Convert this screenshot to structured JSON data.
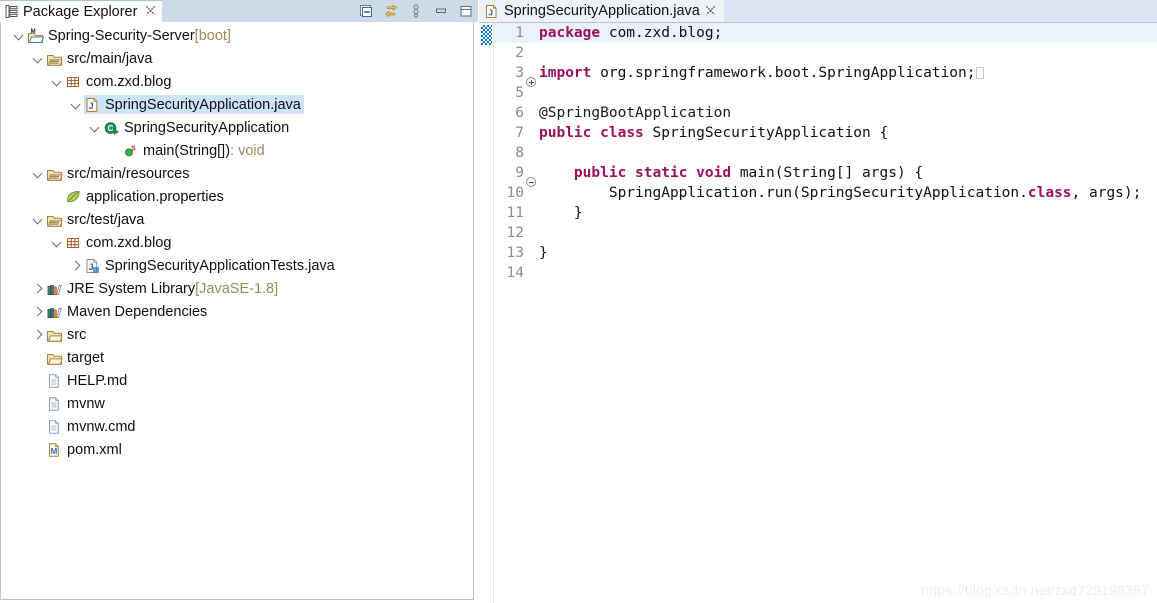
{
  "explorer": {
    "tab": {
      "title": "Package Explorer",
      "close": "✖",
      "icon": "package-explorer-icon"
    },
    "toolbar": [
      {
        "name": "collapse-all-button",
        "title": "Collapse All"
      },
      {
        "name": "link-with-editor-button",
        "title": "Link with Editor"
      },
      {
        "name": "view-menu-button",
        "title": "View Menu"
      },
      {
        "name": "minimize-view-button",
        "title": "Minimize"
      },
      {
        "name": "maximize-view-button",
        "title": "Maximize"
      }
    ],
    "tree": [
      {
        "depth": 0,
        "twisty": "open",
        "icon": "maven-project-icon",
        "label": "Spring-Security-Server",
        "suffix": " [boot]",
        "suffixStyle": "tsuffix",
        "selected": false
      },
      {
        "depth": 1,
        "twisty": "open",
        "icon": "source-folder-icon",
        "label": "src/main/java",
        "suffix": "",
        "suffixStyle": "tsuffix",
        "selected": false
      },
      {
        "depth": 2,
        "twisty": "open",
        "icon": "package-icon",
        "label": "com.zxd.blog",
        "suffix": "",
        "suffixStyle": "tsuffix",
        "selected": false
      },
      {
        "depth": 3,
        "twisty": "open",
        "icon": "java-file-icon",
        "label": "SpringSecurityApplication.java",
        "suffix": "",
        "suffixStyle": "tsuffix",
        "selected": true
      },
      {
        "depth": 4,
        "twisty": "open",
        "icon": "java-class-run-icon",
        "label": "SpringSecurityApplication",
        "suffix": "",
        "suffixStyle": "tsuffix",
        "selected": false
      },
      {
        "depth": 5,
        "twisty": "none",
        "icon": "method-static-icon",
        "label": "main(String[])",
        "suffix": " : void",
        "suffixStyle": "tsuffix ret",
        "selected": false
      },
      {
        "depth": 1,
        "twisty": "open",
        "icon": "source-folder-icon",
        "label": "src/main/resources",
        "suffix": "",
        "suffixStyle": "tsuffix",
        "selected": false
      },
      {
        "depth": 2,
        "twisty": "none",
        "icon": "spring-leaf-icon",
        "label": "application.properties",
        "suffix": "",
        "suffixStyle": "tsuffix",
        "selected": false
      },
      {
        "depth": 1,
        "twisty": "open",
        "icon": "source-folder-icon",
        "label": "src/test/java",
        "suffix": "",
        "suffixStyle": "tsuffix",
        "selected": false
      },
      {
        "depth": 2,
        "twisty": "open",
        "icon": "package-icon",
        "label": "com.zxd.blog",
        "suffix": "",
        "suffixStyle": "tsuffix",
        "selected": false
      },
      {
        "depth": 3,
        "twisty": "closed",
        "icon": "java-test-file-icon",
        "label": "SpringSecurityApplicationTests.java",
        "suffix": "",
        "suffixStyle": "tsuffix",
        "selected": false
      },
      {
        "depth": 1,
        "twisty": "closed",
        "icon": "library-icon",
        "label": "JRE System Library",
        "suffix": " [JavaSE-1.8]",
        "suffixStyle": "tsuffix",
        "selected": false
      },
      {
        "depth": 1,
        "twisty": "closed",
        "icon": "library-icon",
        "label": "Maven Dependencies",
        "suffix": "",
        "suffixStyle": "tsuffix",
        "selected": false
      },
      {
        "depth": 1,
        "twisty": "closed",
        "icon": "folder-icon",
        "label": "src",
        "suffix": "",
        "suffixStyle": "tsuffix",
        "selected": false
      },
      {
        "depth": 1,
        "twisty": "none",
        "icon": "folder-icon",
        "label": "target",
        "suffix": "",
        "suffixStyle": "tsuffix",
        "selected": false
      },
      {
        "depth": 1,
        "twisty": "none",
        "icon": "file-icon",
        "label": "HELP.md",
        "suffix": "",
        "suffixStyle": "tsuffix",
        "selected": false
      },
      {
        "depth": 1,
        "twisty": "none",
        "icon": "file-icon",
        "label": "mvnw",
        "suffix": "",
        "suffixStyle": "tsuffix",
        "selected": false
      },
      {
        "depth": 1,
        "twisty": "none",
        "icon": "file-icon",
        "label": "mvnw.cmd",
        "suffix": "",
        "suffixStyle": "tsuffix",
        "selected": false
      },
      {
        "depth": 1,
        "twisty": "none",
        "icon": "maven-pom-icon",
        "label": "pom.xml",
        "suffix": "",
        "suffixStyle": "tsuffix",
        "selected": false
      }
    ]
  },
  "editor": {
    "tab": {
      "title": "SpringSecurityApplication.java",
      "close": "✖",
      "icon": "java-file-icon"
    },
    "annotation_marker": {
      "line": 1,
      "name": "occurrence-annotation-marker"
    },
    "lines": [
      {
        "n": "1",
        "fold": "none",
        "highlight": true,
        "indent": 0,
        "tokens": [
          {
            "t": "package",
            "c": "kw"
          },
          {
            "t": " com.zxd.blog;",
            "c": ""
          }
        ]
      },
      {
        "n": "2",
        "fold": "none",
        "highlight": false,
        "indent": 0,
        "tokens": []
      },
      {
        "n": "3",
        "fold": "plus",
        "highlight": false,
        "indent": 0,
        "tokens": [
          {
            "t": "import",
            "c": "kw"
          },
          {
            "t": " org.springframework.boot.SpringApplication;",
            "c": ""
          },
          {
            "t": "",
            "c": "ghost"
          }
        ]
      },
      {
        "n": "5",
        "fold": "none",
        "highlight": false,
        "indent": 0,
        "tokens": []
      },
      {
        "n": "6",
        "fold": "none",
        "highlight": false,
        "indent": 0,
        "tokens": [
          {
            "t": "@SpringBootApplication",
            "c": "anno"
          }
        ]
      },
      {
        "n": "7",
        "fold": "none",
        "highlight": false,
        "indent": 0,
        "tokens": [
          {
            "t": "public",
            "c": "kw"
          },
          {
            "t": " ",
            "c": ""
          },
          {
            "t": "class",
            "c": "kw"
          },
          {
            "t": " SpringSecurityApplication {",
            "c": ""
          }
        ]
      },
      {
        "n": "8",
        "fold": "none",
        "highlight": false,
        "indent": 0,
        "tokens": []
      },
      {
        "n": "9",
        "fold": "minus",
        "highlight": false,
        "indent": 0,
        "tokens": [
          {
            "t": "    ",
            "c": ""
          },
          {
            "t": "public",
            "c": "kw"
          },
          {
            "t": " ",
            "c": ""
          },
          {
            "t": "static",
            "c": "kw"
          },
          {
            "t": " ",
            "c": ""
          },
          {
            "t": "void",
            "c": "kw"
          },
          {
            "t": " main(String[] args) {",
            "c": ""
          }
        ]
      },
      {
        "n": "10",
        "fold": "none",
        "highlight": false,
        "indent": 0,
        "tokens": [
          {
            "t": "        SpringApplication.run(SpringSecurityApplication.",
            "c": ""
          },
          {
            "t": "class",
            "c": "kw"
          },
          {
            "t": ", args);",
            "c": ""
          }
        ]
      },
      {
        "n": "11",
        "fold": "none",
        "highlight": false,
        "indent": 0,
        "tokens": [
          {
            "t": "    }",
            "c": ""
          }
        ]
      },
      {
        "n": "12",
        "fold": "none",
        "highlight": false,
        "indent": 0,
        "tokens": []
      },
      {
        "n": "13",
        "fold": "none",
        "highlight": false,
        "indent": 0,
        "tokens": [
          {
            "t": "}",
            "c": ""
          }
        ]
      },
      {
        "n": "14",
        "fold": "none",
        "highlight": false,
        "indent": 0,
        "tokens": []
      }
    ]
  },
  "watermark": "https://blog.csdn.net/zxd729198387",
  "colors": {
    "keyword": "#9c1060",
    "selection": "#cde3f7",
    "tabbar": "#cddbe9",
    "current_line": "#eaf1fb",
    "annotation_marker": "#0a70c0",
    "suffix_text": "#9c8a5c"
  }
}
